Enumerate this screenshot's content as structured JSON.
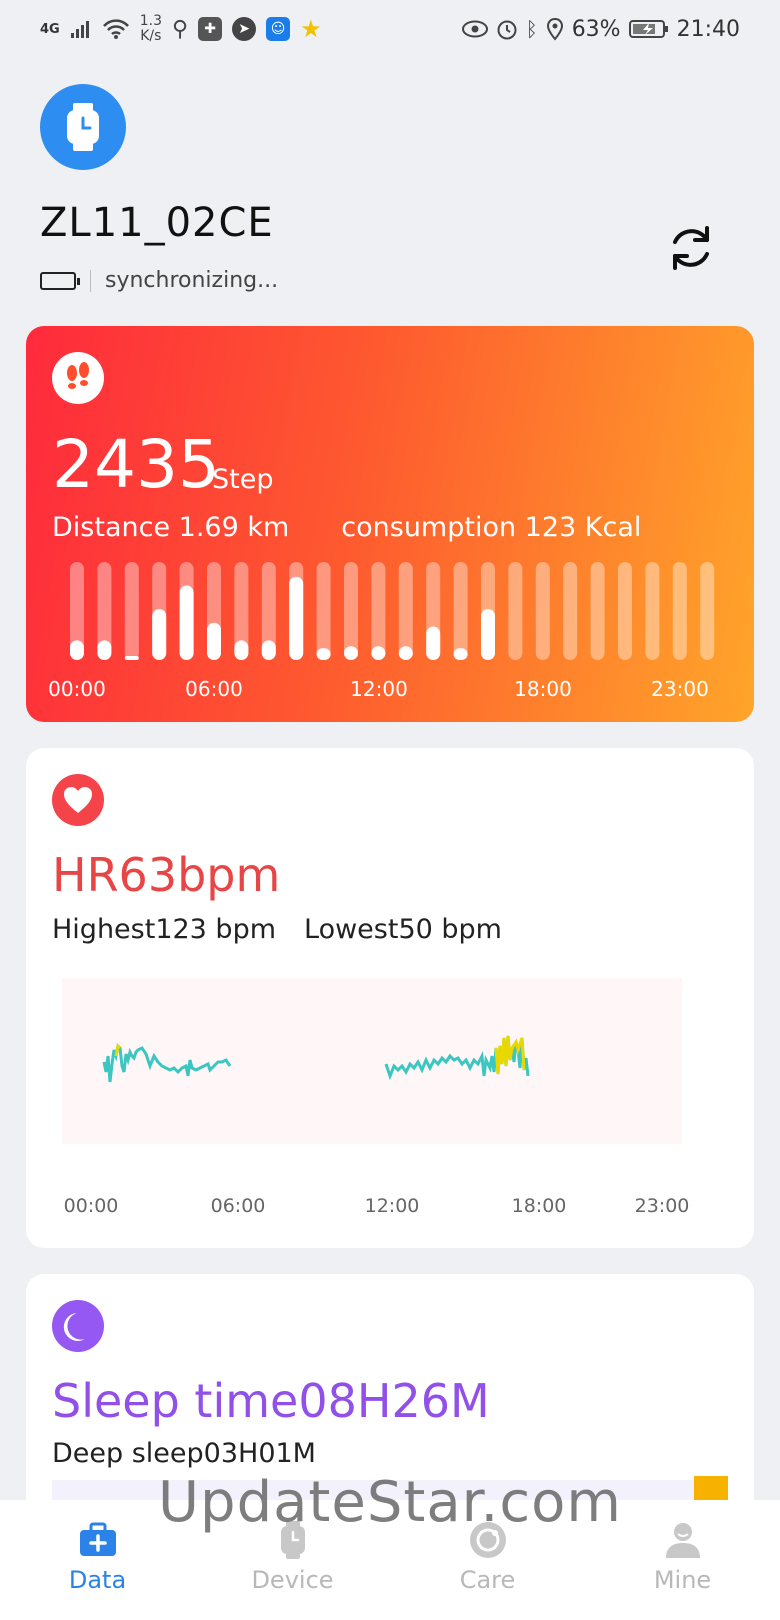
{
  "status_bar": {
    "network": "4G",
    "speed_value": "1.3",
    "speed_unit": "K/s",
    "battery": "63%",
    "time": "21:40"
  },
  "device": {
    "name": "ZL11_02CE",
    "sync_status": "synchronizing..."
  },
  "steps": {
    "value": "2435",
    "unit": "Step",
    "distance": "Distance 1.69 km",
    "consumption": "consumption 123 Kcal",
    "hourly_levels": [
      0.2,
      0.2,
      0.04,
      0.52,
      0.76,
      0.38,
      0.2,
      0.2,
      0.85,
      0.12,
      0.14,
      0.14,
      0.14,
      0.34,
      0.12,
      0.52,
      0,
      0,
      0,
      0,
      0,
      0,
      0,
      0
    ],
    "time_labels": [
      "00:00",
      "06:00",
      "12:00",
      "18:00",
      "23:00"
    ]
  },
  "heart_rate": {
    "title": "HR63bpm",
    "highest": "Highest123 bpm",
    "lowest": "Lowest50 bpm",
    "time_labels": [
      "00:00",
      "06:00",
      "12:00",
      "18:00",
      "23:00"
    ],
    "line_color": "#3cc6c2",
    "highlight_color": "#e8d800"
  },
  "sleep": {
    "title": "Sleep time08H26M",
    "deep_sleep": "Deep sleep03H01M",
    "accent_color": "#f7b200"
  },
  "watermark": "UpdateStar.com",
  "nav": [
    {
      "label": "Data",
      "icon": "medical-kit-icon",
      "active": true
    },
    {
      "label": "Device",
      "icon": "watch-icon",
      "active": false
    },
    {
      "label": "Care",
      "icon": "care-icon",
      "active": false
    },
    {
      "label": "Mine",
      "icon": "person-icon",
      "active": false
    }
  ]
}
